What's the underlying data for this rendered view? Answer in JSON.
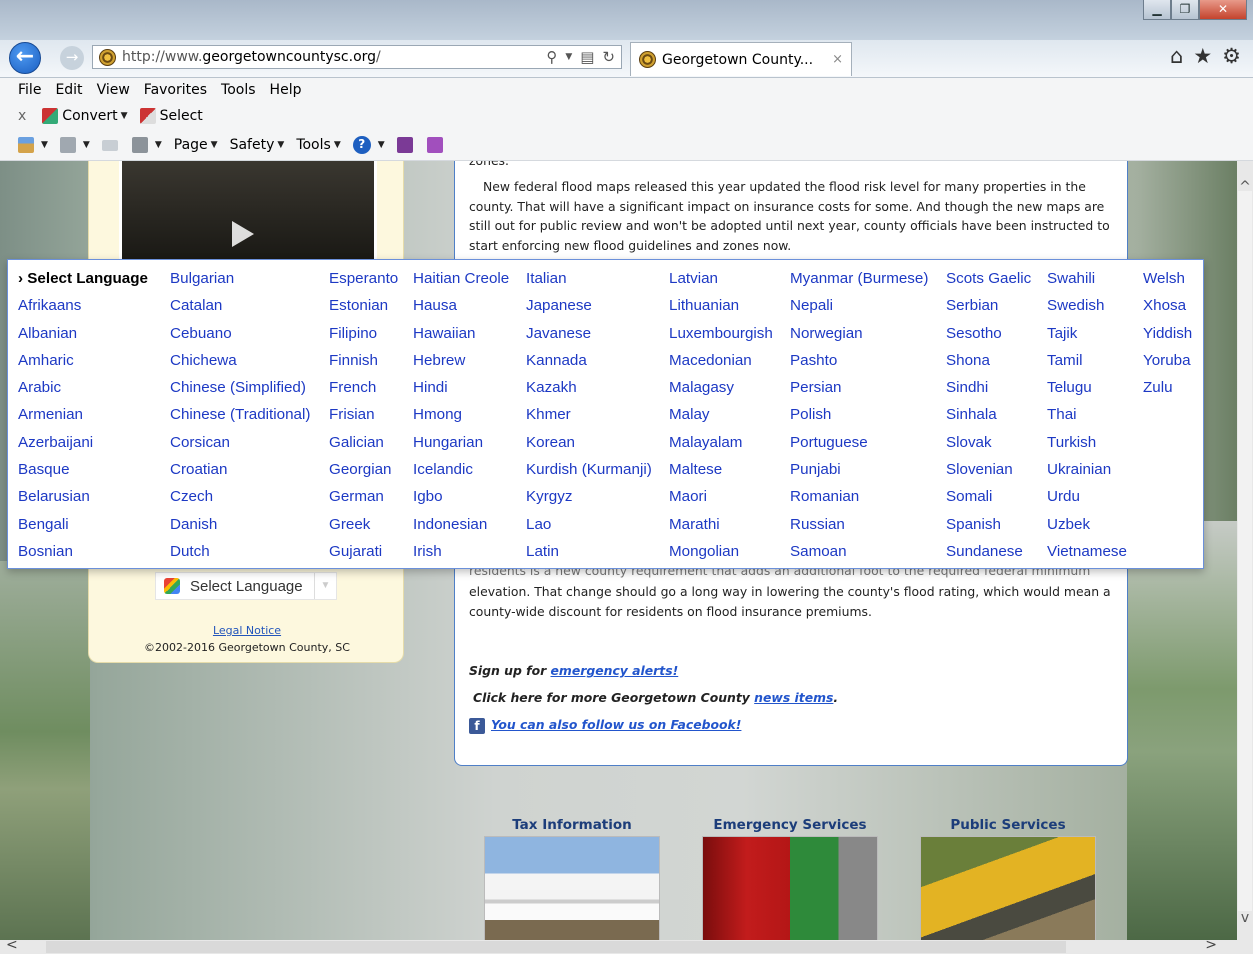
{
  "browser": {
    "url_prefix": "http://www.",
    "url_host": "georgetowncountysc.org",
    "url_suffix": "/",
    "tab_title": "Georgetown County...",
    "tab_close": "×",
    "search_glyph": "⚲",
    "home_glyph": "⌂",
    "favorites_glyph": "★",
    "settings_glyph": "⚙"
  },
  "menubar": [
    "File",
    "Edit",
    "View",
    "Favorites",
    "Tools",
    "Help"
  ],
  "cmdbar1": {
    "close": "x",
    "convert": "Convert",
    "select": "Select"
  },
  "cmdbar2": {
    "page": "Page",
    "safety": "Safety",
    "tools": "Tools"
  },
  "sidebar": {
    "select_language": "Select Language",
    "legal_notice": "Legal Notice",
    "copyright": "©2002-2016 Georgetown County, SC"
  },
  "article": {
    "top_cut": "zones.",
    "para1": "New federal flood maps released this year updated the flood risk level for many properties in the county. That will have a significant impact on insurance costs for some. And though the new maps are still out for public review and won't be adopted until next year, county officials have been instructed to start enforcing new flood guidelines and zones now.",
    "mid_cut": "residents is a new county requirement that adds an additional foot to the required federal minimum",
    "para2": "elevation. That change should go a long way in lowering the county's flood rating, which would mean a county-wide discount for residents on flood insurance premiums.",
    "promo1_text": "Sign up for ",
    "promo1_link": "emergency alerts!",
    "promo2_text": "Click here for more Georgetown County ",
    "promo2_link": "news items",
    "promo2_end": ".",
    "promo3_link": "You can also follow us on Facebook!",
    "fb_glyph": "f"
  },
  "services": [
    {
      "title": "Tax Information"
    },
    {
      "title": "Emergency Services"
    },
    {
      "title": "Public Services"
    }
  ],
  "language_menu": {
    "columns": [
      [
        "› Select Language",
        "Afrikaans",
        "Albanian",
        "Amharic",
        "Arabic",
        "Armenian",
        "Azerbaijani",
        "Basque",
        "Belarusian",
        "Bengali",
        "Bosnian"
      ],
      [
        "Bulgarian",
        "Catalan",
        "Cebuano",
        "Chichewa",
        "Chinese (Simplified)",
        "Chinese (Traditional)",
        "Corsican",
        "Croatian",
        "Czech",
        "Danish",
        "Dutch"
      ],
      [
        "Esperanto",
        "Estonian",
        "Filipino",
        "Finnish",
        "French",
        "Frisian",
        "Galician",
        "Georgian",
        "German",
        "Greek",
        "Gujarati"
      ],
      [
        "Haitian Creole",
        "Hausa",
        "Hawaiian",
        "Hebrew",
        "Hindi",
        "Hmong",
        "Hungarian",
        "Icelandic",
        "Igbo",
        "Indonesian",
        "Irish"
      ],
      [
        "Italian",
        "Japanese",
        "Javanese",
        "Kannada",
        "Kazakh",
        "Khmer",
        "Korean",
        "Kurdish (Kurmanji)",
        "Kyrgyz",
        "Lao",
        "Latin"
      ],
      [
        "Latvian",
        "Lithuanian",
        "Luxembourgish",
        "Macedonian",
        "Malagasy",
        "Malay",
        "Malayalam",
        "Maltese",
        "Maori",
        "Marathi",
        "Mongolian"
      ],
      [
        "Myanmar (Burmese)",
        "Nepali",
        "Norwegian",
        "Pashto",
        "Persian",
        "Polish",
        "Portuguese",
        "Punjabi",
        "Romanian",
        "Russian",
        "Samoan"
      ],
      [
        "Scots Gaelic",
        "Serbian",
        "Sesotho",
        "Shona",
        "Sindhi",
        "Sinhala",
        "Slovak",
        "Slovenian",
        "Somali",
        "Spanish",
        "Sundanese"
      ],
      [
        "Swahili",
        "Swedish",
        "Tajik",
        "Tamil",
        "Telugu",
        "Thai",
        "Turkish",
        "Ukrainian",
        "Urdu",
        "Uzbek",
        "Vietnamese"
      ],
      [
        "Welsh",
        "Xhosa",
        "Yiddish",
        "Yoruba",
        "Zulu"
      ]
    ]
  }
}
